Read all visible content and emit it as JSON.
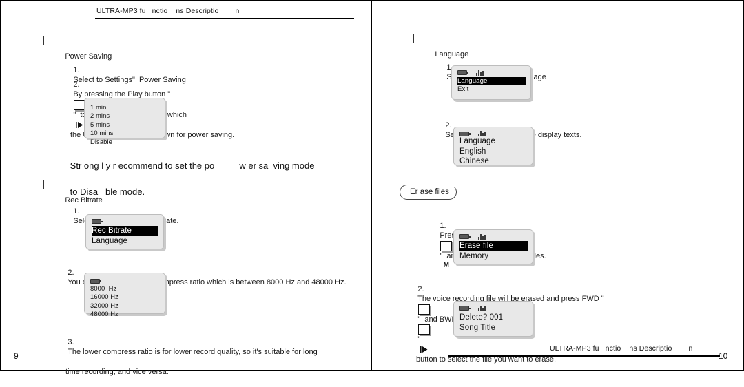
{
  "doc": {
    "running_head": "ULTRA-MP3 fu   nctio    ns Descriptio        n"
  },
  "left_page": {
    "folio": "9",
    "sections": [
      {
        "heading": "Power Saving",
        "items": [
          {
            "num": "1.",
            "text": "Select to Settings\"  Power Saving"
          },
          {
            "num": "2.",
            "pre": "By pressing the Play button \"",
            "icon": "play-button-icon",
            "post": "\"  to select the timeout after which",
            "line2": "the ULTRA-MP3 will shut down for power saving."
          }
        ]
      },
      {
        "heading": "Rec Bitrate",
        "items": [
          {
            "num": "1.",
            "text": "Select to Settings\"  Rec Bitrate."
          },
          {
            "num": "2.",
            "text": "You can select the record compress ratio which is between 8000 Hz and 48000 Hz."
          },
          {
            "num": "3.",
            "text": "The lower compress ratio is for lower record quality, so it's suitable for long",
            "line2": "time recording, and vice versa."
          }
        ]
      }
    ],
    "note": {
      "line1": "Str ong l y r ecommend to set the po          w er sa  ving mode",
      "line2": "to Disa   ble mode."
    },
    "lcd_timeout": {
      "name": "power-saving-timeout-screen",
      "icons": [],
      "rows": [
        {
          "text": "1 min",
          "selected": false
        },
        {
          "text": "2 mins",
          "selected": false
        },
        {
          "text": "5 mins",
          "selected": false
        },
        {
          "text": "10 mins",
          "selected": false
        },
        {
          "text": "Disable",
          "selected": false
        }
      ]
    },
    "lcd_recbitrate": {
      "name": "rec-bitrate-menu-screen",
      "icons": [
        "battery-icon"
      ],
      "rows": [
        {
          "text": "Rec Bitrate",
          "selected": true
        },
        {
          "text": "Language",
          "selected": false
        }
      ]
    },
    "lcd_frequency": {
      "name": "record-frequency-screen",
      "icons": [
        "battery-icon"
      ],
      "rows": [
        {
          "text": "8000  Hz",
          "selected": false
        },
        {
          "text": "16000 Hz",
          "selected": false
        },
        {
          "text": "32000 Hz",
          "selected": false
        },
        {
          "text": "48000 Hz",
          "selected": false
        }
      ]
    }
  },
  "right_page": {
    "folio": "10",
    "sections": [
      {
        "heading": "Language",
        "items": [
          {
            "num": "1.",
            "text": "Select to Settings\"  Language"
          },
          {
            "num": "2.",
            "text": "Select the language for the display texts."
          }
        ]
      }
    ],
    "oval_heading": "Er ase files",
    "erase_items": [
      {
        "num": "1.",
        "pre": "Press the M button \"",
        "icon": "m-button-icon",
        "post": "\"  and then select to Erase files."
      },
      {
        "num": "2.",
        "pre": "The voice recording file will be erased and press FWD \"",
        "icon": "fwd-button-icon",
        "mid": "\"  and BWD \"",
        "icon2": "bwd-button-icon",
        "post": "\"",
        "line2": "button to select the file you want to erase."
      }
    ],
    "lcd_language_menu": {
      "name": "language-menu-screen",
      "icons": [
        "battery-icon",
        "speaker-icon"
      ],
      "rows": [
        {
          "text": "Language",
          "selected": true
        },
        {
          "text": "Exit",
          "selected": false
        }
      ]
    },
    "lcd_language_choice": {
      "name": "language-choice-screen",
      "icons": [
        "battery-icon",
        "speaker-icon"
      ],
      "rows": [
        {
          "text": "Language",
          "selected": false
        },
        {
          "text": "English",
          "selected": false
        },
        {
          "text": "Chinese",
          "selected": false
        }
      ]
    },
    "lcd_erase_menu": {
      "name": "erase-file-menu-screen",
      "icons": [
        "battery-icon",
        "speaker-icon"
      ],
      "rows": [
        {
          "text": "Erase file",
          "selected": true
        },
        {
          "text": "Memory",
          "selected": false
        }
      ]
    },
    "lcd_delete_confirm": {
      "name": "delete-confirm-screen",
      "icons": [
        "battery-icon",
        "speaker-icon"
      ],
      "rows": [
        {
          "text": "Delete? 001",
          "selected": false
        },
        {
          "text": "Song Title",
          "selected": false
        }
      ]
    }
  },
  "colors": {
    "page_bg": "#ffffff",
    "ink": "#1a1a1a",
    "lcd_bg": "#e8e8e8",
    "lcd_border": "#bdbdbd",
    "lcd_shadow": "#c9c9c9",
    "highlight_bg": "#000000",
    "highlight_fg": "#ffffff"
  }
}
